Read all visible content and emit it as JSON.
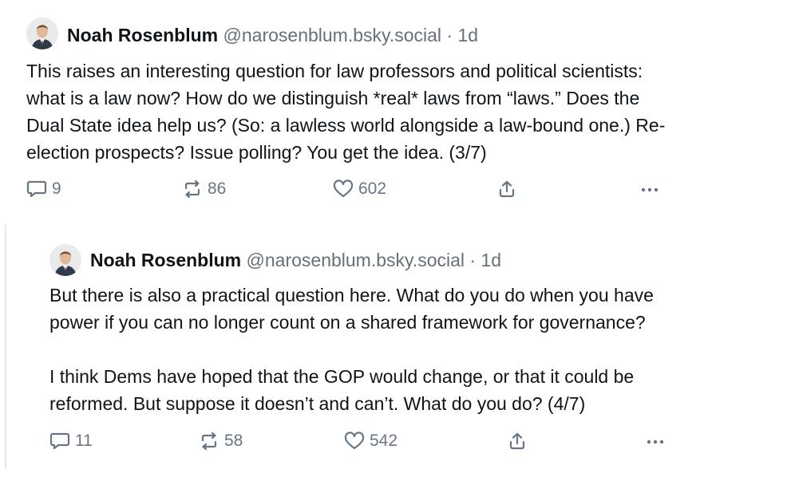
{
  "posts": [
    {
      "author_name": "Noah Rosenblum",
      "handle": "@narosenblum.bsky.social",
      "separator": "·",
      "time": "1d",
      "avatar_icon": "person-avatar-icon",
      "lines": [
        "This raises an interesting question for law professors and political scientists:",
        "what is a law now? How do we distinguish *real* laws from “laws.” Does the",
        "Dual State idea help us? (So: a lawless world alongside a law-bound one.) Re-",
        "election prospects? Issue polling? You get the idea. (3/7)"
      ],
      "replies": "9",
      "reposts": "86",
      "likes": "602"
    },
    {
      "author_name": "Noah Rosenblum",
      "handle": "@narosenblum.bsky.social",
      "separator": "·",
      "time": "1d",
      "avatar_icon": "person-avatar-icon",
      "lines": [
        "But there is also a practical question here. What do you do when you have",
        "power if you can no longer count on a shared framework for governance?",
        "",
        "I think Dems have hoped that the GOP would change, or that it could be",
        "reformed. But suppose it doesn’t and can’t. What do you do? (4/7)"
      ],
      "replies": "11",
      "reposts": "58",
      "likes": "542"
    }
  ],
  "colors": {
    "text": "#0f1419",
    "muted": "#66707a",
    "icon": "#687684",
    "rule": "#e3e6ea"
  }
}
